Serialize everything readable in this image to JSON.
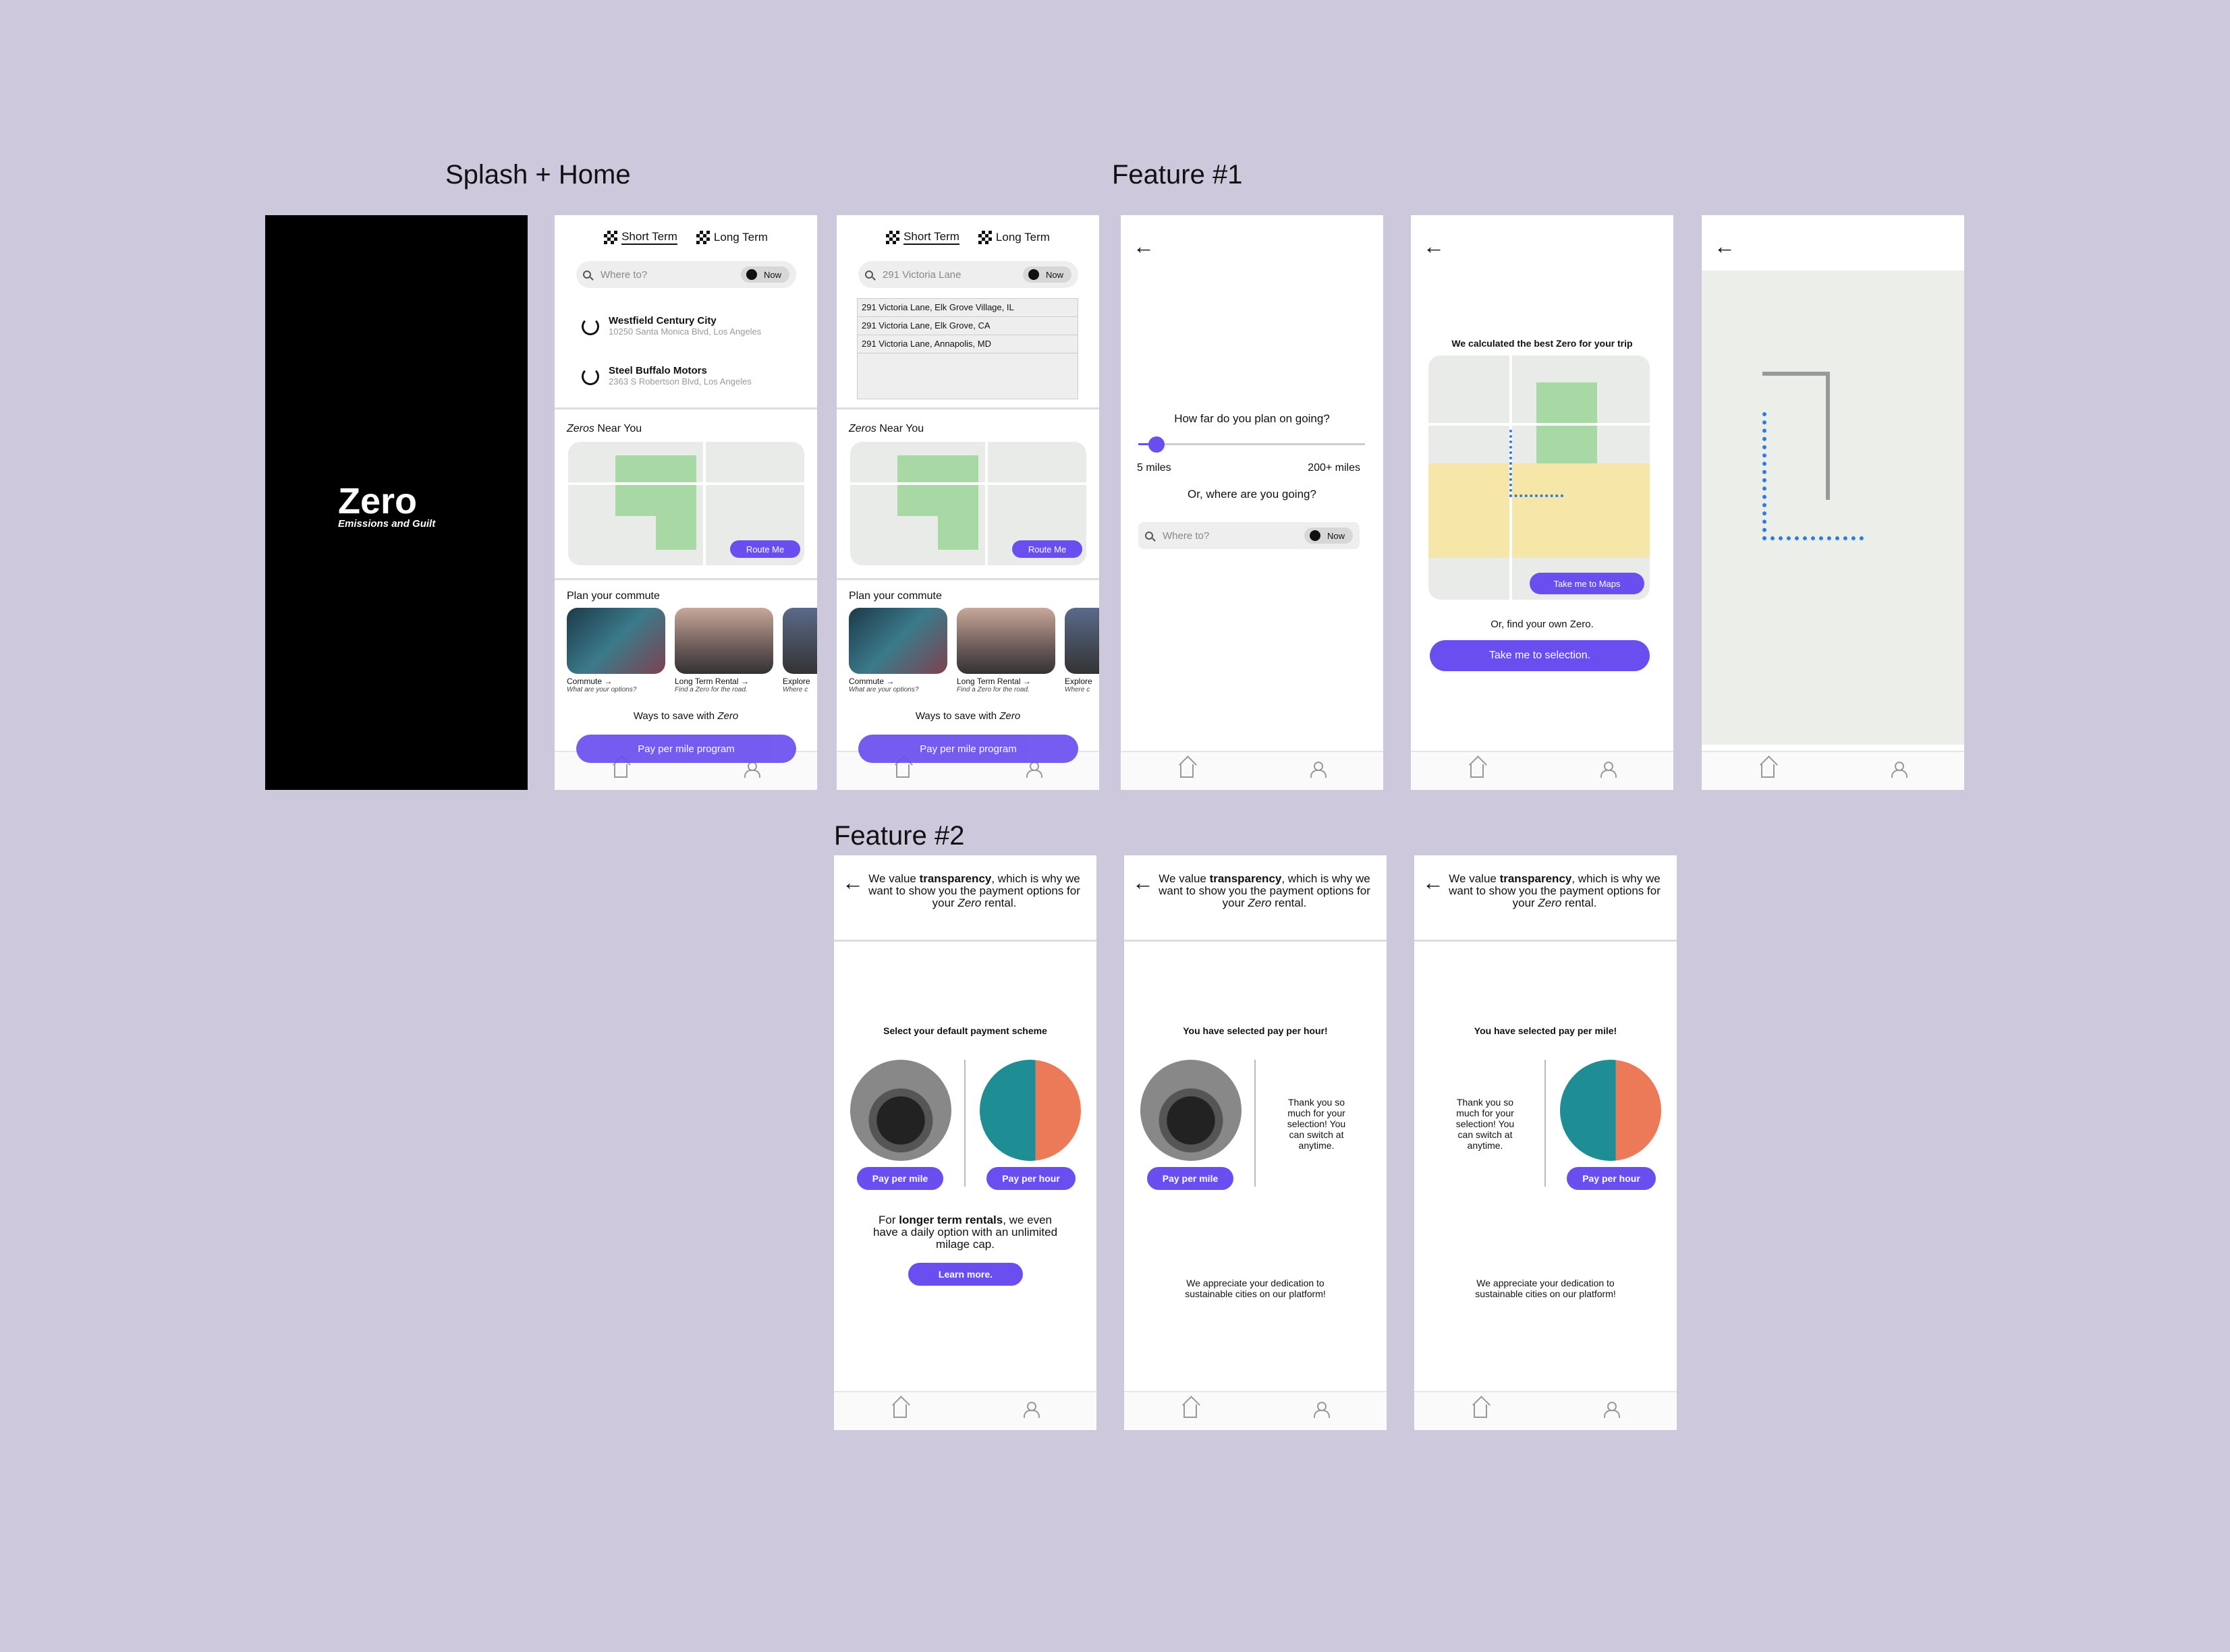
{
  "labels": {
    "splash_home": "Splash + Home",
    "feature1": "Feature #1",
    "feature2": "Feature #2"
  },
  "splash": {
    "title": "Zero",
    "subtitle": "Emissions and Guilt"
  },
  "home": {
    "tabs": [
      "Short Term",
      "Long Term"
    ],
    "search_placeholder": "Where to?",
    "search_value": "291 Victoria Lane",
    "now_label": "Now",
    "recent": [
      {
        "name": "Westfield Century City",
        "address": "10250 Santa Monica Blvd, Los Angeles"
      },
      {
        "name": "Steel Buffalo Motors",
        "address": "2363 S Robertson Blvd, Los Angeles"
      }
    ],
    "suggestions": [
      "291 Victoria Lane, Elk Grove Village, IL",
      "291 Victoria Lane, Elk Grove, CA",
      "291 Victoria Lane, Annapolis, MD"
    ],
    "near_you_em": "Zeros",
    "near_you_rest": " Near You",
    "route_me": "Route Me",
    "plan_title": "Plan your commute",
    "cards": [
      {
        "title": "Commute →",
        "sub": "What are your options?"
      },
      {
        "title": "Long Term Rental →",
        "sub": "Find a Zero for the road."
      },
      {
        "title": "Explore",
        "sub": "Where c"
      }
    ],
    "ways_to_save": "Ways to save with",
    "ways_zero": "Zero",
    "ppm_program": "Pay per mile program"
  },
  "f1": {
    "how_far": "How far do you plan on going?",
    "min": "5 miles",
    "max": "200+ miles",
    "slider_value": 0.08,
    "or_where": "Or, where are you going?",
    "calculated": "We calculated the best Zero for your trip",
    "take_maps": "Take me to Maps",
    "find_own": "Or, find your own Zero.",
    "take_selection": "Take me to selection."
  },
  "f2": {
    "intro_a": "We value ",
    "intro_b": "transparency",
    "intro_c": ", which is why we want to show you the payment options for your ",
    "intro_d": "Zero",
    "intro_e": " rental.",
    "select_default": "Select your default payment scheme",
    "pay_mile": "Pay per mile",
    "pay_hour": "Pay per hour",
    "longer_a": "For ",
    "longer_b": "longer term rentals",
    "longer_c": ", we even have a daily option with an unlimited milage cap.",
    "learn_more": "Learn more.",
    "selected_hour": "You have selected pay per hour!",
    "selected_mile": "You have selected pay per mile!",
    "thanks": "Thank you so much for your selection! You can switch at anytime.",
    "appreciate": "We appreciate your dedication to sustainable cities on our platform!"
  },
  "colors": {
    "accent": "#6b4ef0",
    "background": "#cdc8dc"
  }
}
